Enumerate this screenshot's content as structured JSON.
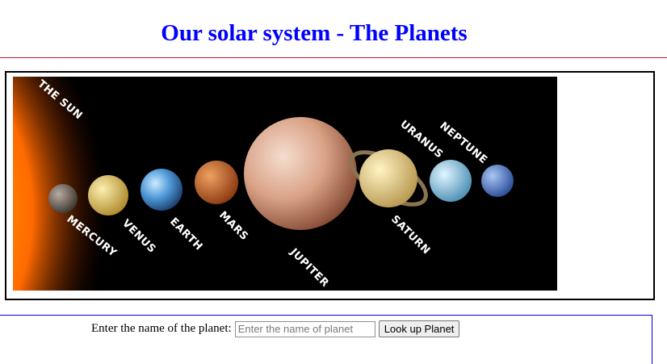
{
  "page": {
    "title": "Our solar system - The Planets"
  },
  "image": {
    "labels": {
      "sun": "THE SUN",
      "mercury": "MERCURY",
      "venus": "VENUS",
      "earth": "EARTH",
      "mars": "MARS",
      "jupiter": "JUPITER",
      "saturn": "SATURN",
      "uranus": "URANUS",
      "neptune": "NEPTUNE"
    }
  },
  "lookup_form": {
    "label": "Enter the name of the planet:",
    "input_value": "",
    "input_placeholder": "Enter the name of planet",
    "button_label": "Look up Planet"
  },
  "colors": {
    "title": "#0000ff",
    "rule": "#b22222",
    "form_border": "#0000cc",
    "image_background": "#000000"
  }
}
